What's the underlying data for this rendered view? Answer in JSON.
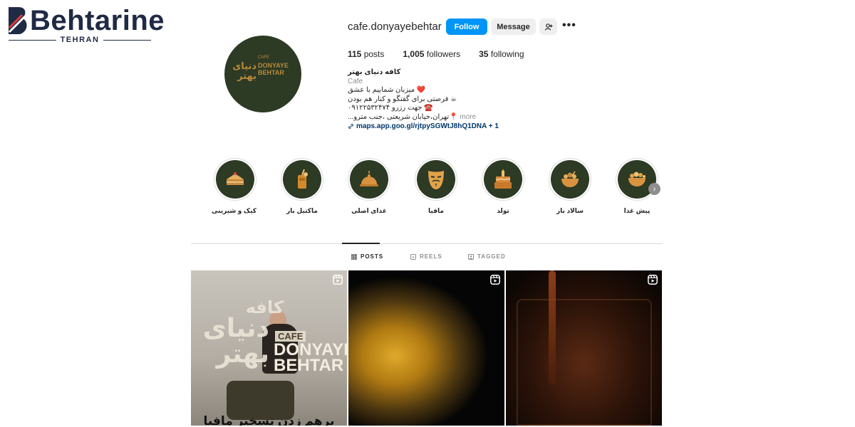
{
  "watermark": {
    "brand": "Behtarine",
    "city": "TEHRAN"
  },
  "profile": {
    "username": "cafe.donyayebehtar",
    "follow_label": "Follow",
    "message_label": "Message",
    "avatar_text_fa": "دنیای بهتر",
    "avatar_text_en_1": "DONYAYE",
    "avatar_text_en_2": "BEHTAR",
    "avatar_cafe": "CAFE"
  },
  "stats": {
    "posts_count": "115",
    "posts_label": "posts",
    "followers_count": "1,005",
    "followers_label": "followers",
    "following_count": "35",
    "following_label": "following"
  },
  "bio": {
    "name": "کافه دنیای بهتر",
    "category": "Cafe",
    "line1": "❤️ میزبان شماییم با عشق",
    "line2": "☕ فرصتی برای گفتگو و کنار هم بودن",
    "line3": "☎️ جهت رزرو ۰۹۱۲۲۵۳۲۴۷۴",
    "line4": "📍تهران،خیابان شریعتی ،جنب مترو...",
    "more": "more",
    "link": "maps.app.goo.gl/rjtpySGWtJ8hQ1DNA + 1"
  },
  "highlights": [
    {
      "label": "کیک و شیرینی",
      "icon": "cake-slice-icon"
    },
    {
      "label": "ماکتیل بار",
      "icon": "drink-icon"
    },
    {
      "label": "غذای اصلی",
      "icon": "cloche-icon"
    },
    {
      "label": "مافیا",
      "icon": "mask-icon"
    },
    {
      "label": "تولد",
      "icon": "birthday-cake-icon"
    },
    {
      "label": "سالاد بار",
      "icon": "salad-bowl-icon"
    },
    {
      "label": "پیش غذا",
      "icon": "appetizer-bowl-icon"
    }
  ],
  "tabs": [
    {
      "label": "POSTS",
      "active": true
    },
    {
      "label": "REELS",
      "active": false
    },
    {
      "label": "TAGGED",
      "active": false
    }
  ],
  "posts": [
    {
      "cafe": "CAFE",
      "brand_en_1": "DONYAYE",
      "brand_en_2": "BEHTAR",
      "brand_fa": "دنیای بهتر",
      "fa_top": "کافه",
      "caption": "برهم زدن تسخیر مافیا"
    },
    {},
    {}
  ],
  "colors": {
    "follow_blue": "#0095f6",
    "brand_green": "#2d3a24",
    "gold": "#b88a3b"
  }
}
